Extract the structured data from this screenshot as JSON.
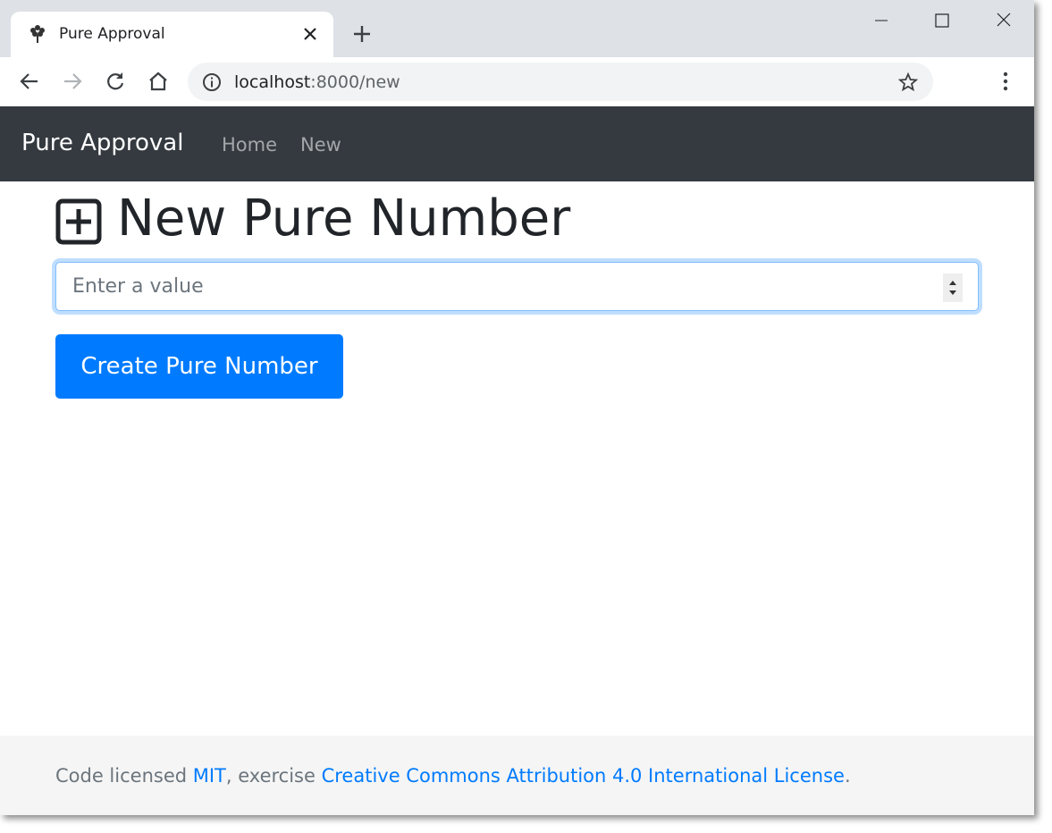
{
  "browser": {
    "tab_title": "Pure Approval",
    "url_host": "localhost",
    "url_path": ":8000/new"
  },
  "navbar": {
    "brand": "Pure Approval",
    "links": [
      "Home",
      "New"
    ],
    "background": "#343a40"
  },
  "main": {
    "heading": "New Pure Number",
    "heading_icon": "plus-square-icon",
    "input_placeholder": "Enter a value",
    "input_value": "",
    "submit_label": "Create Pure Number",
    "accent": "#007bff"
  },
  "footer": {
    "prefix": "Code licensed ",
    "mit_link": "MIT",
    "middle": ", exercise ",
    "cc_link": "Creative Commons Attribution 4.0 International License",
    "suffix": "."
  }
}
